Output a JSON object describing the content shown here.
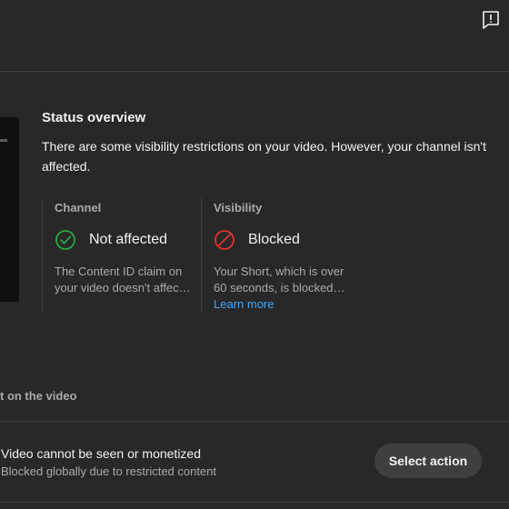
{
  "header": {
    "feedback_icon": "feedback-icon"
  },
  "status": {
    "title": "Status overview",
    "description": "There are some visibility restrictions on your video. However, your channel isn't affected."
  },
  "channel": {
    "label": "Channel",
    "status": "Not affected",
    "status_icon": "check-circle-icon",
    "status_color": "#2ba640",
    "body_line1": "The Content ID claim on",
    "body_line2": "your video doesn't affec…"
  },
  "visibility": {
    "label": "Visibility",
    "status": "Blocked",
    "status_icon": "blocked-icon",
    "status_color": "#e03030",
    "body_line1": "Your Short, which is over",
    "body_line2": "60 seconds, is blocked…",
    "link": "Learn more"
  },
  "impact": {
    "section_label": "t on the video",
    "issue_title": "Video cannot be seen or monetized",
    "issue_subtitle": "Blocked globally due to restricted content",
    "action_label": "Select action"
  }
}
